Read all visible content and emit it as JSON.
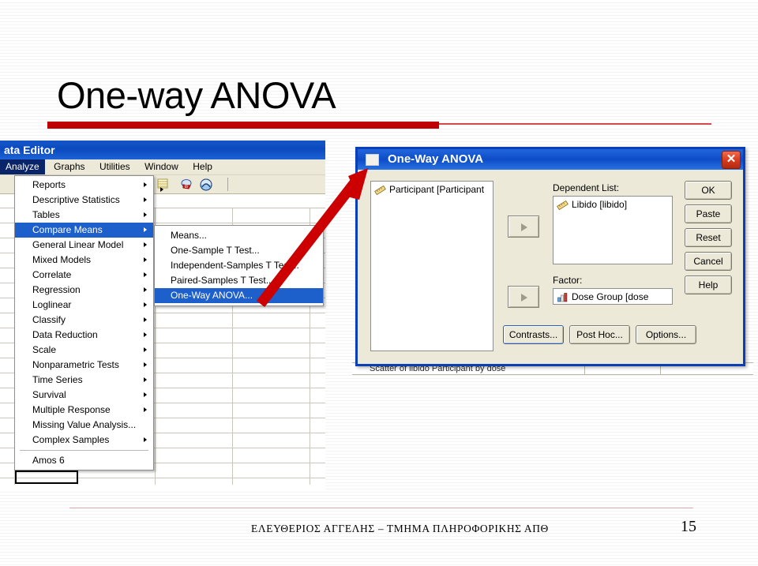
{
  "slide": {
    "title": "One-way ANOVA",
    "footer_text": "ΕΛΕΥΘΕΡΙΟΣ ΑΓΓΕΛΗΣ – ΤΜΗΜΑ ΠΛΗΡΟΦΟΡΙΚΗΣ ΑΠΘ",
    "page_number": "15",
    "accent_color": "#C00000"
  },
  "spss_window": {
    "title": "ata Editor",
    "menubar": [
      {
        "label": "Analyze",
        "active": true
      },
      {
        "label": "Graphs",
        "active": false
      },
      {
        "label": "Utilities",
        "active": false
      },
      {
        "label": "Window",
        "active": false
      },
      {
        "label": "Help",
        "active": false
      }
    ],
    "analyze_menu": [
      {
        "label": "Reports",
        "submenu": true,
        "selected": false
      },
      {
        "label": "Descriptive Statistics",
        "submenu": true,
        "selected": false
      },
      {
        "label": "Tables",
        "submenu": true,
        "selected": false
      },
      {
        "label": "Compare Means",
        "submenu": true,
        "selected": true
      },
      {
        "label": "General Linear Model",
        "submenu": true,
        "selected": false
      },
      {
        "label": "Mixed Models",
        "submenu": true,
        "selected": false
      },
      {
        "label": "Correlate",
        "submenu": true,
        "selected": false
      },
      {
        "label": "Regression",
        "submenu": true,
        "selected": false
      },
      {
        "label": "Loglinear",
        "submenu": true,
        "selected": false
      },
      {
        "label": "Classify",
        "submenu": true,
        "selected": false
      },
      {
        "label": "Data Reduction",
        "submenu": true,
        "selected": false
      },
      {
        "label": "Scale",
        "submenu": true,
        "selected": false
      },
      {
        "label": "Nonparametric Tests",
        "submenu": true,
        "selected": false
      },
      {
        "label": "Time Series",
        "submenu": true,
        "selected": false
      },
      {
        "label": "Survival",
        "submenu": true,
        "selected": false
      },
      {
        "label": "Multiple Response",
        "submenu": true,
        "selected": false
      },
      {
        "label": "Missing Value Analysis...",
        "submenu": false,
        "selected": false
      },
      {
        "label": "Complex Samples",
        "submenu": true,
        "selected": false
      },
      {
        "label": "Amos 6",
        "submenu": false,
        "selected": false
      }
    ],
    "compare_means_submenu": [
      {
        "label": "Means...",
        "selected": false
      },
      {
        "label": "One-Sample T Test...",
        "selected": false
      },
      {
        "label": "Independent-Samples T Test...",
        "selected": false
      },
      {
        "label": "Paired-Samples T Test...",
        "selected": false
      },
      {
        "label": "One-Way ANOVA...",
        "selected": true
      }
    ],
    "background_row_text": "Scatter of libido Participant by dose"
  },
  "anova_dialog": {
    "title": "One-Way ANOVA",
    "close_label": "✕",
    "source_list": [
      {
        "name": "Participant [Participant",
        "icon": "ruler-icon"
      }
    ],
    "dependent_label": "Dependent List:",
    "dependent_list": [
      {
        "name": "Libido [libido]",
        "icon": "ruler-icon"
      }
    ],
    "factor_label": "Factor:",
    "factor_value": {
      "name": "Dose Group [dose",
      "icon": "bar-chart-icon"
    },
    "side_buttons": [
      {
        "label": "OK"
      },
      {
        "label": "Paste"
      },
      {
        "label": "Reset"
      },
      {
        "label": "Cancel"
      },
      {
        "label": "Help"
      }
    ],
    "bottom_buttons": [
      {
        "label": "Contrasts..."
      },
      {
        "label": "Post Hoc..."
      },
      {
        "label": "Options..."
      }
    ],
    "titlebar_color": "#0D4CC6",
    "border_color": "#0A3FB8"
  }
}
